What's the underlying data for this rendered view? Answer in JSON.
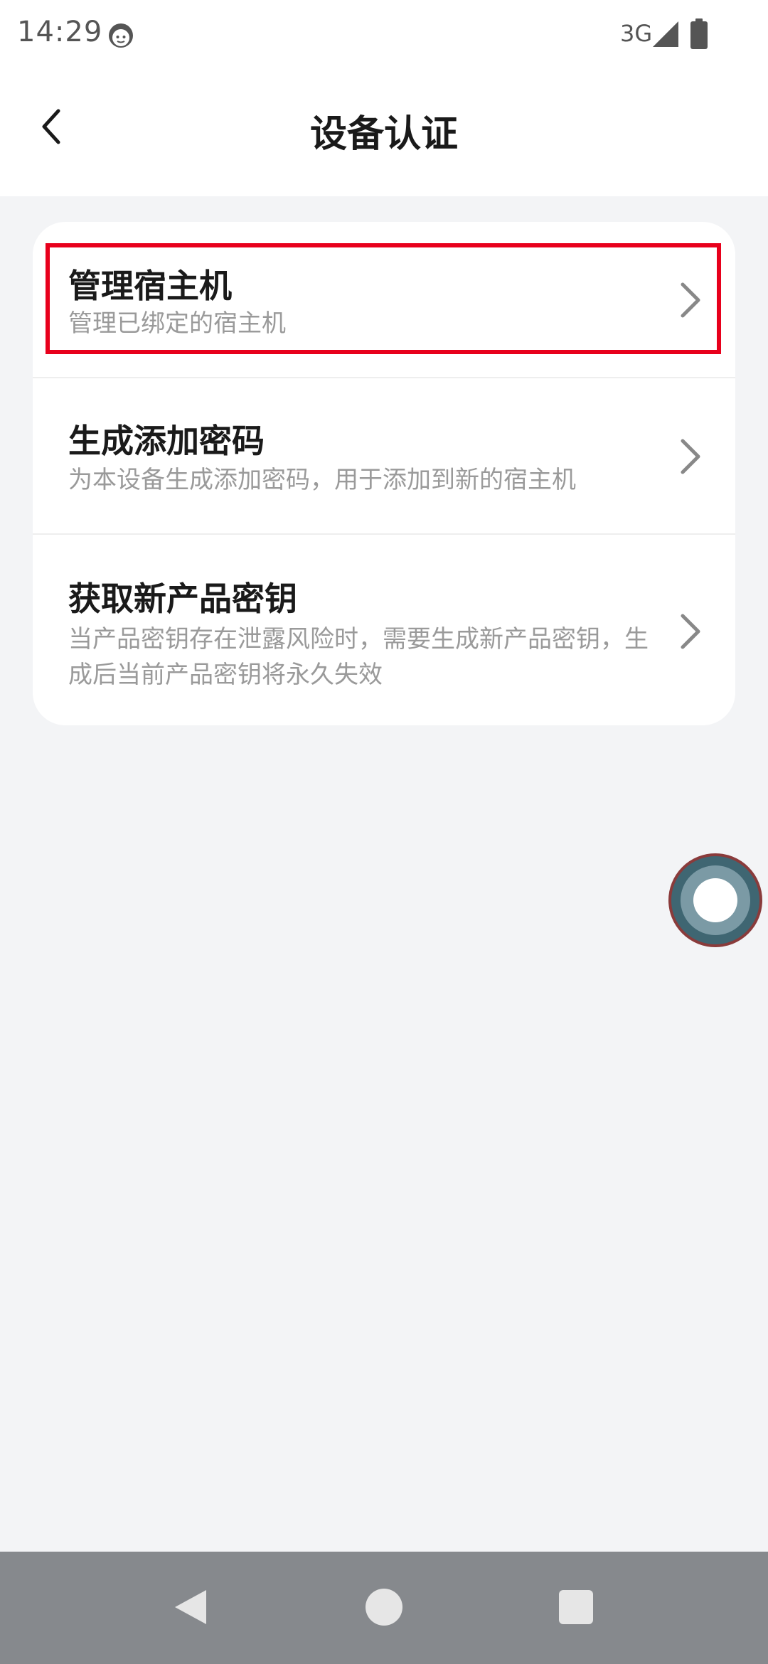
{
  "status_bar": {
    "time": "14:29",
    "network": "3G",
    "icons": [
      "app-face-icon",
      "signal-icon",
      "battery-icon"
    ]
  },
  "header": {
    "title": "设备认证",
    "back_icon": "chevron-left-icon"
  },
  "menu": {
    "items": [
      {
        "title": "管理宿主机",
        "description": "管理已绑定的宿主机",
        "highlighted": true
      },
      {
        "title": "生成添加密码",
        "description": "为本设备生成添加密码，用于添加到新的宿主机"
      },
      {
        "title": "获取新产品密钥",
        "description": "当产品密钥存在泄露风险时，需要生成新产品密钥，生成后当前产品密钥将永久失效"
      }
    ]
  },
  "colors": {
    "highlight": "#e8001c",
    "background": "#f3f4f6",
    "card": "#ffffff",
    "nav_bar": "#86898d"
  },
  "navigation": {
    "icons": [
      "nav-back-icon",
      "nav-home-icon",
      "nav-recents-icon"
    ]
  }
}
